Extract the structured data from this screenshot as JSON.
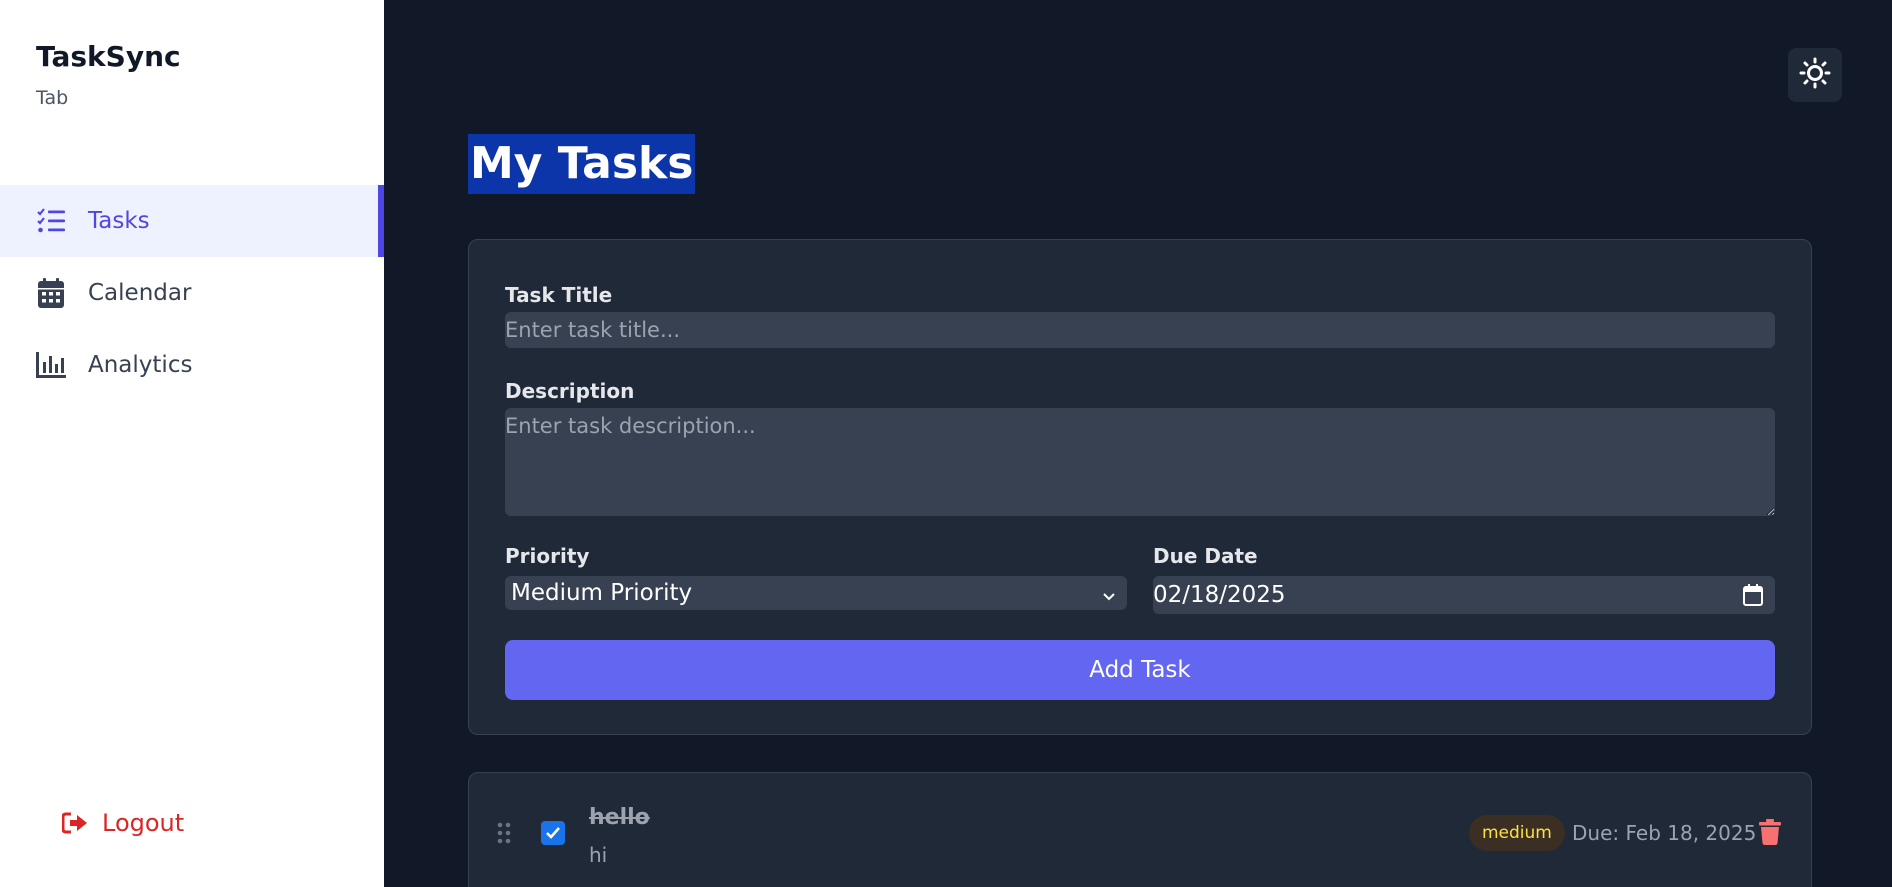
{
  "sidebar": {
    "brand_title": "TaskSync",
    "brand_subtitle": "Tab",
    "items": [
      {
        "label": "Tasks",
        "icon": "tasks-list-icon"
      },
      {
        "label": "Calendar",
        "icon": "calendar-icon"
      },
      {
        "label": "Analytics",
        "icon": "chart-bar-icon"
      }
    ],
    "logout_label": "Logout"
  },
  "header": {
    "title": "My Tasks",
    "theme_icon": "sun-icon"
  },
  "form": {
    "title_label": "Task Title",
    "title_placeholder": "Enter task title...",
    "description_label": "Description",
    "description_placeholder": "Enter task description...",
    "priority_label": "Priority",
    "priority_value": "Medium Priority",
    "due_label": "Due Date",
    "due_value": "02/18/2025",
    "add_label": "Add Task"
  },
  "tasks": [
    {
      "title": "hello",
      "description": "hi",
      "completed": true,
      "priority": "medium",
      "due": "Due: Feb 18, 2025"
    }
  ],
  "colors": {
    "accent": "#6366f1",
    "active_nav": "#4f46e5",
    "danger": "#dc2626",
    "priority_medium": "#fde047",
    "background": "#111827",
    "card": "#1f2937"
  }
}
